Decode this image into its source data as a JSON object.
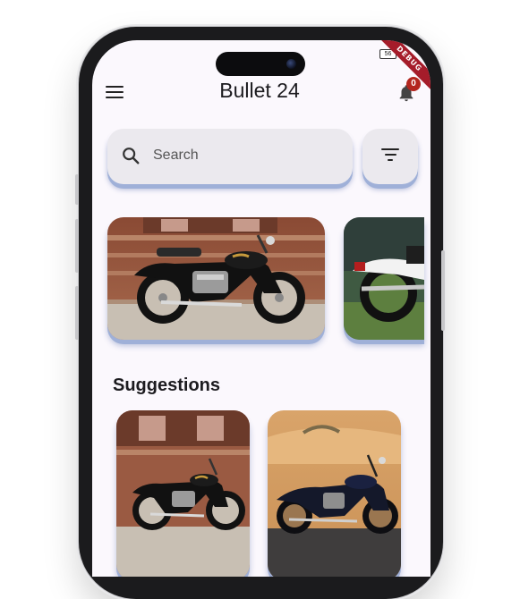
{
  "app": {
    "title": "Bullet 24"
  },
  "status": {
    "battery": "56",
    "debug_banner": "DEBUG"
  },
  "notifications": {
    "count": "0"
  },
  "search": {
    "placeholder": "Search"
  },
  "sections": {
    "suggestions_title": "Suggestions"
  },
  "colors": {
    "accent_shadow": "#9fb0d8",
    "badge": "#b3261e",
    "surface": "#ebe9ee",
    "background": "#fbf8fd"
  },
  "icons": {
    "menu": "menu-icon",
    "bell": "bell-icon",
    "search": "search-icon",
    "filter": "filter-icon"
  }
}
